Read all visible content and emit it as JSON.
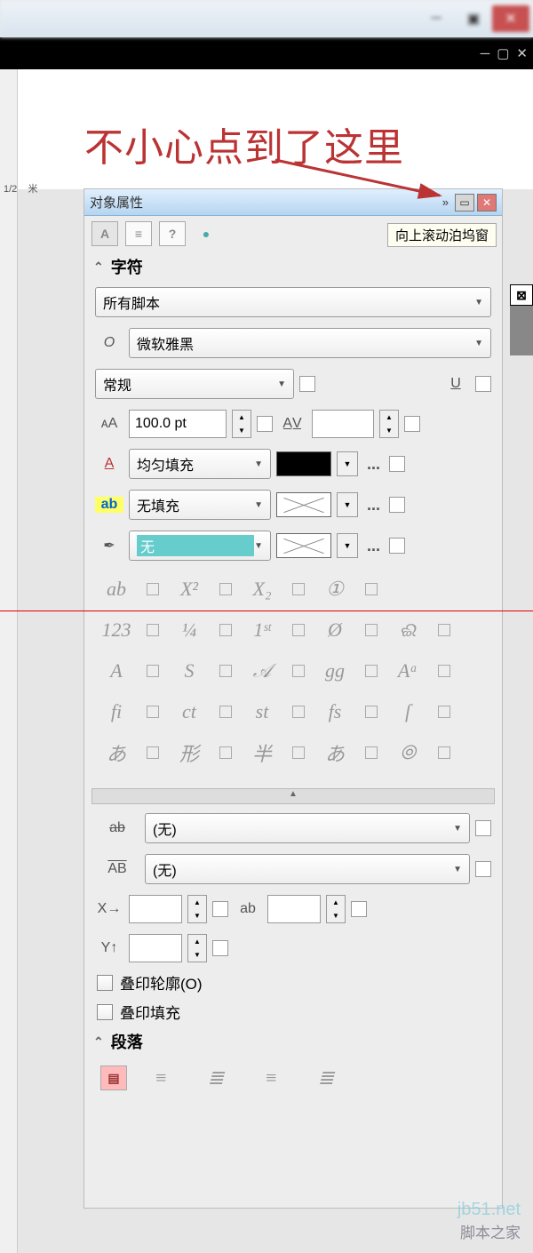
{
  "annotation_text": "不小心点到了这里",
  "ruler": {
    "label_left": "1/2",
    "label_right": "米"
  },
  "panel": {
    "title": "对象属性",
    "tooltip": "向上滚动泊坞窗",
    "tabs": {
      "char": "A",
      "align": "≡",
      "frame": "?",
      "dot": "●"
    },
    "section_char": "字符",
    "section_para": "段落",
    "script_dd": "所有脚本",
    "font_dd": "微软雅黑",
    "font_prefix": "O",
    "weight_dd": "常规",
    "size_label": "ᴀA",
    "size_value": "100.0 pt",
    "kerning_label": "A̲V̲",
    "underline_label": "U",
    "fill_icon": "A",
    "fill_dd": "均匀填充",
    "bg_icon": "ab",
    "bg_dd": "无填充",
    "outline_icon": "✒",
    "outline_dd": "无",
    "strike_icon": "ab",
    "overline_icon": "AB",
    "xoff_icon": "X→",
    "yoff_icon": "Y↑",
    "none_val": "(无)",
    "ab_icon": "ab",
    "overprint_outline": "叠印轮廓(O)",
    "overprint_fill": "叠印填充",
    "glyphs": {
      "r1": [
        "ab",
        "X²",
        "X₂",
        "①"
      ],
      "r2": [
        "123",
        "¼",
        "1ˢᵗ",
        "Ø",
        "ଈ"
      ],
      "r3": [
        "A",
        "S",
        "𝒜",
        "gg",
        "Aᵃ"
      ],
      "r4": [
        "fi",
        "ct",
        "st",
        "fs",
        "ſ"
      ],
      "r5": [
        "あ",
        "形",
        "半",
        "あ",
        "⦾"
      ]
    }
  },
  "colors": [
    "#000",
    "#333",
    "#444",
    "#555",
    "#777",
    "#999",
    "#bbb",
    "#ddd",
    "#fff",
    "#063",
    "#096",
    "#0c3",
    "#6c0",
    "#cc0",
    "#f90",
    "#f06",
    "#c09",
    "#90c",
    "#66c",
    "#39c",
    "#6cf",
    "#9cc",
    "#cde",
    "#abc",
    "#9ab",
    "#789",
    "#678",
    "#567"
  ],
  "watermark": {
    "domain": "jb51.net",
    "text": "脚本之家"
  }
}
